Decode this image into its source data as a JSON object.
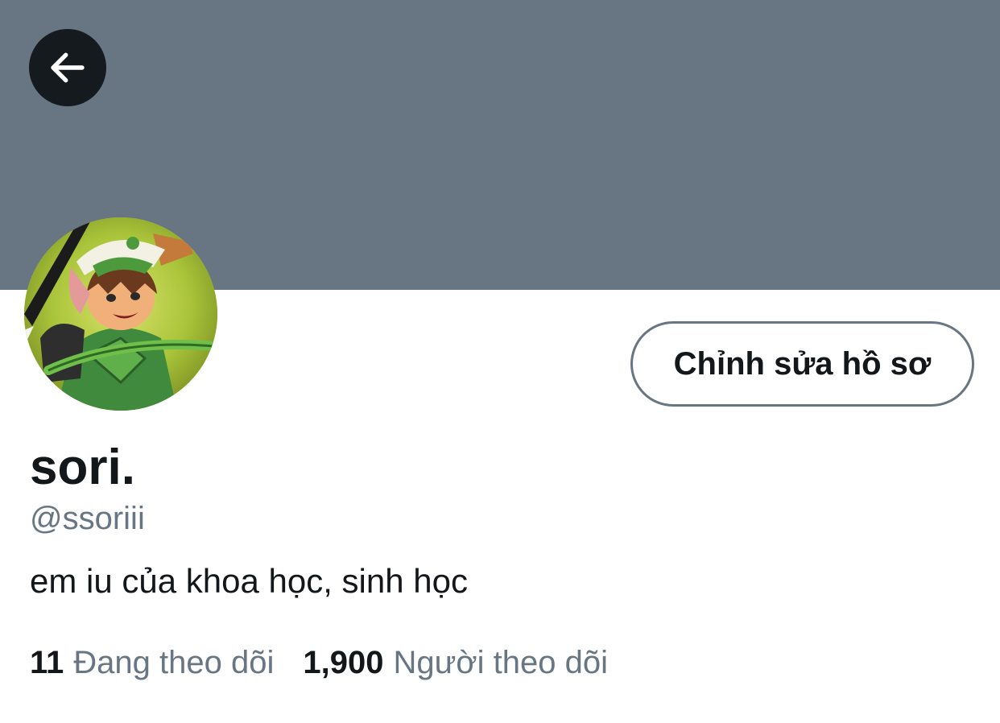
{
  "header": {
    "banner_color": "#687684",
    "back_icon": "arrow-left-icon"
  },
  "profile": {
    "avatar_description_icon": "avatar-image",
    "edit_button_label": "Chỉnh sửa hồ sơ",
    "display_name": "sori.",
    "handle": "@ssoriii",
    "bio": "em iu của khoa học, sinh học"
  },
  "stats": {
    "following_count": "11",
    "following_label": "Đang theo dõi",
    "followers_count": "1,900",
    "followers_label": "Người theo dõi"
  },
  "colors": {
    "text_primary": "#14171a",
    "text_secondary": "#687684",
    "back_button_bg": "#151a1f"
  }
}
